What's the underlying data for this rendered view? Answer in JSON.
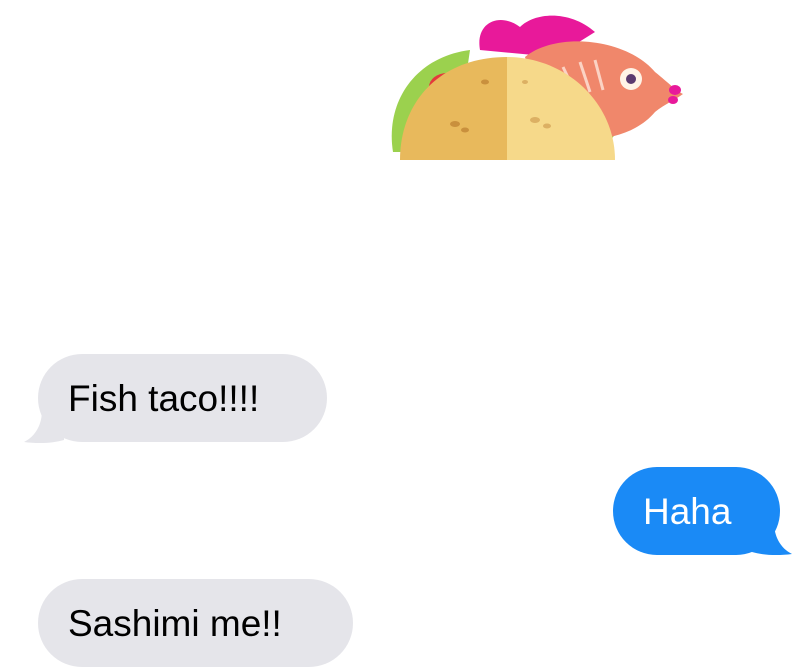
{
  "conversation": {
    "messages": [
      {
        "direction": "incoming",
        "text": "Fish taco!!!!"
      },
      {
        "direction": "outgoing",
        "text": "Haha"
      },
      {
        "direction": "incoming",
        "text": "Sashimi me!!"
      }
    ],
    "sticker": {
      "icon": "fish-taco-sticker-icon"
    }
  },
  "colors": {
    "incoming_bubble": "#e5e5ea",
    "outgoing_bubble": "#1a8af6",
    "background": "#ffffff"
  }
}
